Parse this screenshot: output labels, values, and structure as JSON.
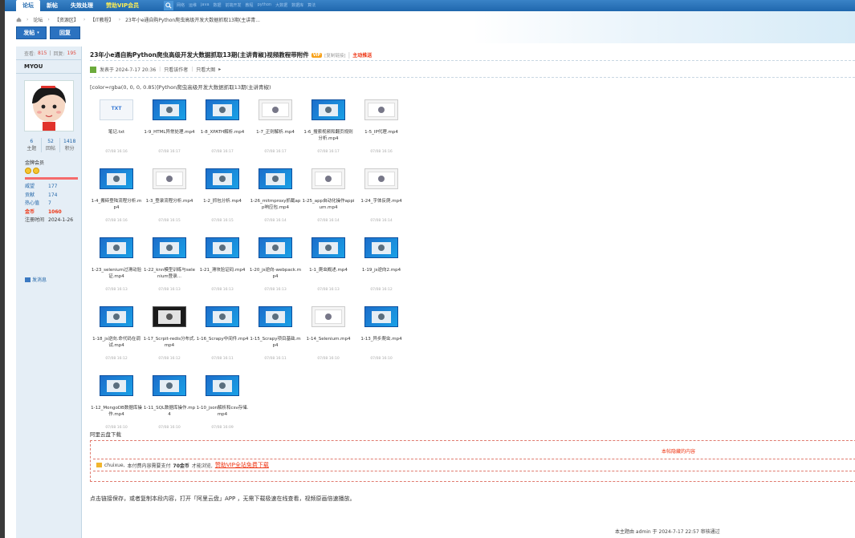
{
  "nav": {
    "items": [
      {
        "label": "论坛",
        "active": true
      },
      {
        "label": "新帖"
      },
      {
        "label": "失效处理"
      },
      {
        "label": "赞助VIP会员",
        "vip": true
      }
    ],
    "hotwords": [
      "网络",
      "运维",
      "java",
      "数据",
      "前端开发",
      "教程",
      "python",
      "大数据",
      "数据库",
      "算法"
    ]
  },
  "breadcrumb": {
    "home": "论坛",
    "section": "【资源区】",
    "forum": "【IT教程】",
    "thread": "23年小e通自购Python爬虫高级开发大数据抓取13期(主讲青..."
  },
  "actions": {
    "post": "发帖",
    "reply": "回复"
  },
  "sidebar": {
    "views_label": "查看:",
    "views": "815",
    "replies_label": "回复:",
    "replies": "195",
    "username": "MYOU",
    "counts": [
      {
        "n": "6",
        "label": "主题"
      },
      {
        "n": "52",
        "label": "回帖"
      },
      {
        "n": "1418",
        "label": "积分"
      }
    ],
    "group": "金牌会员",
    "attrs": [
      {
        "k": "威望",
        "v": "177",
        "style": ""
      },
      {
        "k": "贡献",
        "v": "174",
        "style": ""
      },
      {
        "k": "热心值",
        "v": "7",
        "style": ""
      },
      {
        "k": "金币",
        "v": "1060",
        "style": "red"
      },
      {
        "k": "注册时间",
        "v": "2024-1-26",
        "style": "plain"
      }
    ],
    "pm": "发消息"
  },
  "post": {
    "title": "23年小e通自购Python爬虫高级开发大数据抓取13期(主讲青椒)视频教程带附件",
    "vip_badge": "VIP",
    "copy": "[复制链接]",
    "push": "主动推送",
    "posted": "发表于 2024-7-17 20:36",
    "author_only": "只看该作者",
    "big_only": "只看大图",
    "body": "[color=rgba(0, 0, 0, 0.85)]Python爬虫高级开发大数据抓取13期(主讲青椒)",
    "aliyun": "阿里云盘下载",
    "hidden_title": "本帖隐藏的内容",
    "notice_user": "chuixue,",
    "notice_text": "本付费内容需要支付",
    "notice_cost": "70金币",
    "notice_tail": "才能浏览,",
    "notice_vip": "赞助VIP全站免费下载",
    "tail": "点击链接保存，或者复制本段内容，打开「阿里云盘」APP ，无需下载极速在线查看，视频原画倍速播放。",
    "footer": "本主题由 admin 于 2024-7-17 22:57 审核通过"
  },
  "attachments": [
    {
      "name": "笔记.txt",
      "date": "07/08 16:16",
      "kind": "txt"
    },
    {
      "name": "1-9_HTML异常处理.mp4",
      "date": "07/08 16:17",
      "kind": "video"
    },
    {
      "name": "1-8_XPATH解析.mp4",
      "date": "07/08 16:17",
      "kind": "video"
    },
    {
      "name": "1-7_正则解析.mp4",
      "date": "07/08 16:17",
      "kind": "light"
    },
    {
      "name": "1-6_搜索视频和翻页规则分析.mp4",
      "date": "07/08 16:17",
      "kind": "video"
    },
    {
      "name": "1-5_IP代理.mp4",
      "date": "07/08 16:16",
      "kind": "light"
    },
    {
      "name": "1-4_搬砖登陆流程分析.mp4",
      "date": "07/08 16:16",
      "kind": "video"
    },
    {
      "name": "1-3_登录流程分析.mp4",
      "date": "07/08 16:15",
      "kind": "light"
    },
    {
      "name": "1-2_抓包分析.mp4",
      "date": "07/08 16:15",
      "kind": "video"
    },
    {
      "name": "1-26_mitmproxy抓截app响应包.mp4",
      "date": "07/08 16:14",
      "kind": "video"
    },
    {
      "name": "1-25_app自动化操作appium.mp4",
      "date": "07/08 16:14",
      "kind": "light"
    },
    {
      "name": "1-24_字体反爬.mp4",
      "date": "07/08 16:14",
      "kind": "light"
    },
    {
      "name": "1-23_selenium过滑动验证.mp4",
      "date": "07/08 16:13",
      "kind": "video"
    },
    {
      "name": "1-22_knn模型训练与selenium登录...",
      "date": "07/08 16:13",
      "kind": "video"
    },
    {
      "name": "1-21_滑块验证码.mp4",
      "date": "07/08 16:13",
      "kind": "video"
    },
    {
      "name": "1-20_js逆向-webpack.mp4",
      "date": "07/08 16:13",
      "kind": "video"
    },
    {
      "name": "1-1_爬虫概述.mp4",
      "date": "07/08 16:13",
      "kind": "video"
    },
    {
      "name": "1-19_js逆向2.mp4",
      "date": "07/08 16:12",
      "kind": "video"
    },
    {
      "name": "1-18_js逆向.命代码在调试.mp4",
      "date": "07/08 16:12",
      "kind": "video"
    },
    {
      "name": "1-17_Scrpit-redis分布式.mp4",
      "date": "07/08 16:12",
      "kind": "dark"
    },
    {
      "name": "1-16_Scrapy中间件.mp4",
      "date": "07/08 16:11",
      "kind": "video"
    },
    {
      "name": "1-15_Scrapy项目基础.mp4",
      "date": "07/08 16:11",
      "kind": "video"
    },
    {
      "name": "1-14_Selenium.mp4",
      "date": "07/08 16:10",
      "kind": "light"
    },
    {
      "name": "1-13_异步爬虫.mp4",
      "date": "07/08 16:10",
      "kind": "video"
    },
    {
      "name": "1-12_MongoDB数据库操作.mp4",
      "date": "07/08 16:10",
      "kind": "video"
    },
    {
      "name": "1-11_SQL数据库操作.mp4",
      "date": "07/08 16:10",
      "kind": "video"
    },
    {
      "name": "1-10_json解析和csv存储.mp4",
      "date": "07/08 16:09",
      "kind": "video"
    }
  ]
}
